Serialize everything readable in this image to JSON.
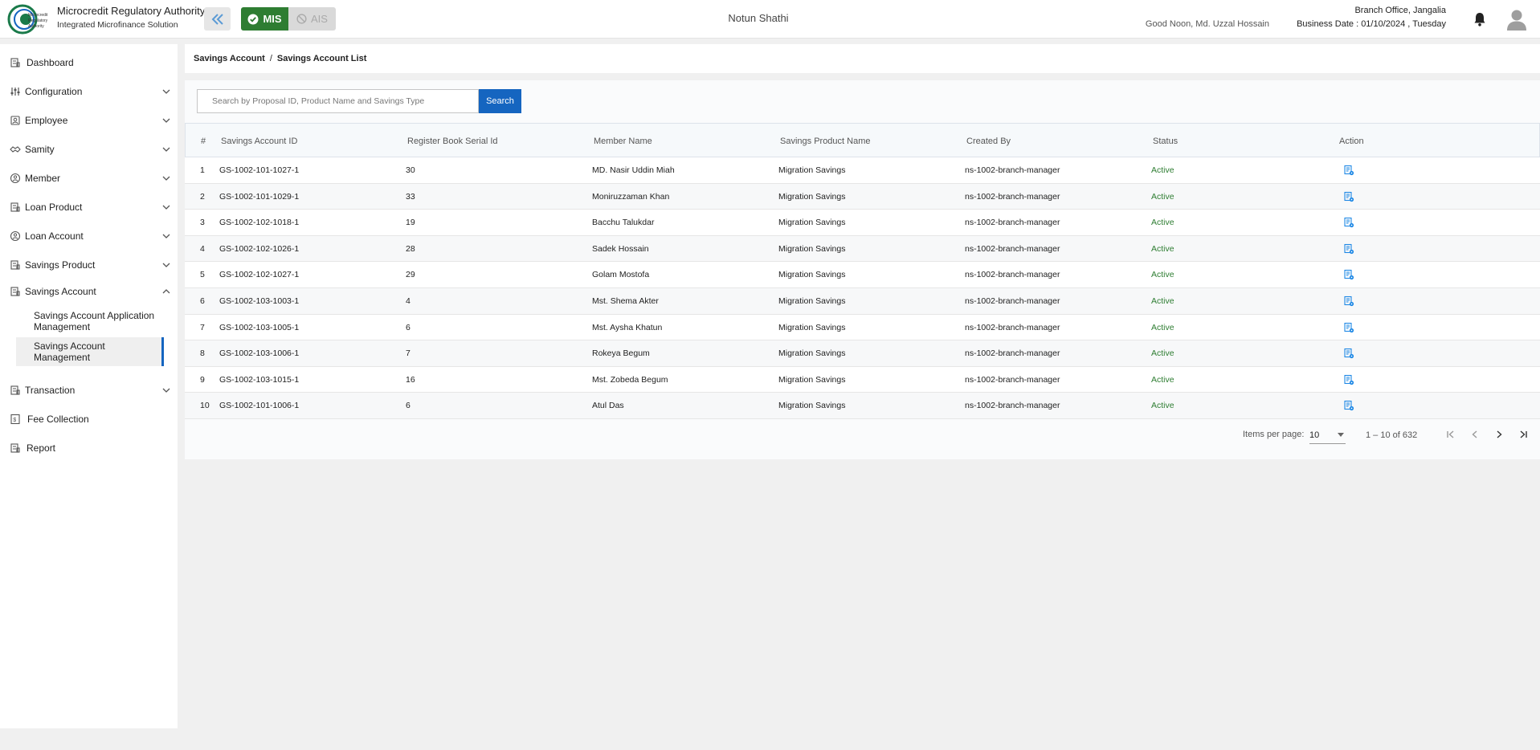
{
  "header": {
    "org_name": "Microcredit Regulatory Authority",
    "org_sub": "Integrated Microfinance Solution",
    "mis_label": "MIS",
    "ais_label": "AIS",
    "company": "Notun Shathi",
    "greeting": "Good Noon, Md. Uzzal Hossain",
    "branch": "Branch Office, Jangalia",
    "business_date": "Business Date : 01/10/2024 , Tuesday"
  },
  "sidebar": {
    "items": [
      {
        "label": "Dashboard"
      },
      {
        "label": "Configuration"
      },
      {
        "label": "Employee"
      },
      {
        "label": "Samity"
      },
      {
        "label": "Member"
      },
      {
        "label": "Loan Product"
      },
      {
        "label": "Loan Account"
      },
      {
        "label": "Savings Product"
      },
      {
        "label": "Savings Account"
      },
      {
        "label": "Transaction"
      },
      {
        "label": "Fee Collection"
      },
      {
        "label": "Report"
      }
    ],
    "sub_items": [
      {
        "label": "Savings Account Application Management"
      },
      {
        "label": "Savings Account Management"
      }
    ]
  },
  "breadcrumb": {
    "parent": "Savings Account",
    "separator": "/",
    "current": "Savings Account List"
  },
  "search": {
    "placeholder": "Search by Proposal ID, Product Name and Savings Type",
    "button": "Search"
  },
  "table": {
    "headers": [
      "#",
      "Savings Account ID",
      "Register Book Serial Id",
      "Member Name",
      "Savings Product Name",
      "Created By",
      "Status",
      "Action"
    ],
    "rows": [
      [
        "1",
        "GS-1002-101-1027-1",
        "30",
        "MD. Nasir Uddin Miah",
        "Migration Savings",
        "ns-1002-branch-manager",
        "Active"
      ],
      [
        "2",
        "GS-1002-101-1029-1",
        "33",
        "Moniruzzaman Khan",
        "Migration Savings",
        "ns-1002-branch-manager",
        "Active"
      ],
      [
        "3",
        "GS-1002-102-1018-1",
        "19",
        "Bacchu Talukdar",
        "Migration Savings",
        "ns-1002-branch-manager",
        "Active"
      ],
      [
        "4",
        "GS-1002-102-1026-1",
        "28",
        "Sadek Hossain",
        "Migration Savings",
        "ns-1002-branch-manager",
        "Active"
      ],
      [
        "5",
        "GS-1002-102-1027-1",
        "29",
        "Golam Mostofa",
        "Migration Savings",
        "ns-1002-branch-manager",
        "Active"
      ],
      [
        "6",
        "GS-1002-103-1003-1",
        "4",
        "Mst. Shema Akter",
        "Migration Savings",
        "ns-1002-branch-manager",
        "Active"
      ],
      [
        "7",
        "GS-1002-103-1005-1",
        "6",
        "Mst. Aysha Khatun",
        "Migration Savings",
        "ns-1002-branch-manager",
        "Active"
      ],
      [
        "8",
        "GS-1002-103-1006-1",
        "7",
        "Rokeya Begum",
        "Migration Savings",
        "ns-1002-branch-manager",
        "Active"
      ],
      [
        "9",
        "GS-1002-103-1015-1",
        "16",
        "Mst. Zobeda Begum",
        "Migration Savings",
        "ns-1002-branch-manager",
        "Active"
      ],
      [
        "10",
        "GS-1002-101-1006-1",
        "6",
        "Atul Das",
        "Migration Savings",
        "ns-1002-branch-manager",
        "Active"
      ]
    ]
  },
  "paginator": {
    "items_per_page_label": "Items per page:",
    "items_per_page": "10",
    "range": "1 – 10 of 632"
  },
  "colors": {
    "mis_green": "#2e7d32",
    "primary_blue": "#1565c0",
    "status_active": "#2e7d32"
  }
}
